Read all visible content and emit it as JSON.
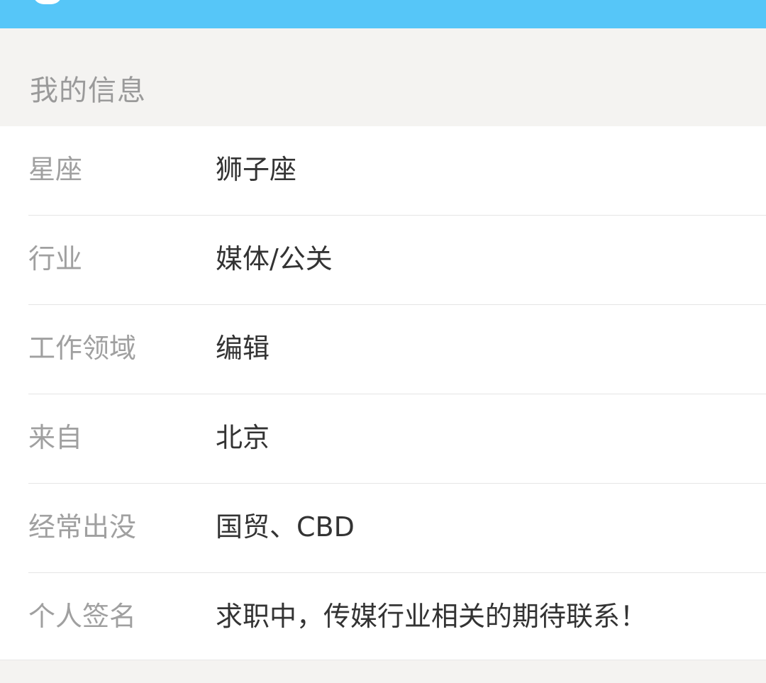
{
  "colors": {
    "top_bar": "#56c6f8",
    "background": "#f4f3f1",
    "card": "#ffffff",
    "label_text": "#a0a0a0",
    "value_text": "#333333",
    "divider": "#e5e5e5"
  },
  "section": {
    "title": "我的信息"
  },
  "rows": [
    {
      "label": "星座",
      "value": "狮子座"
    },
    {
      "label": "行业",
      "value": "媒体/公关"
    },
    {
      "label": "工作领域",
      "value": "编辑"
    },
    {
      "label": "来自",
      "value": "北京"
    },
    {
      "label": "经常出没",
      "value": "国贸、CBD"
    },
    {
      "label": "个人签名",
      "value": "求职中，传媒行业相关的期待联系！"
    }
  ]
}
